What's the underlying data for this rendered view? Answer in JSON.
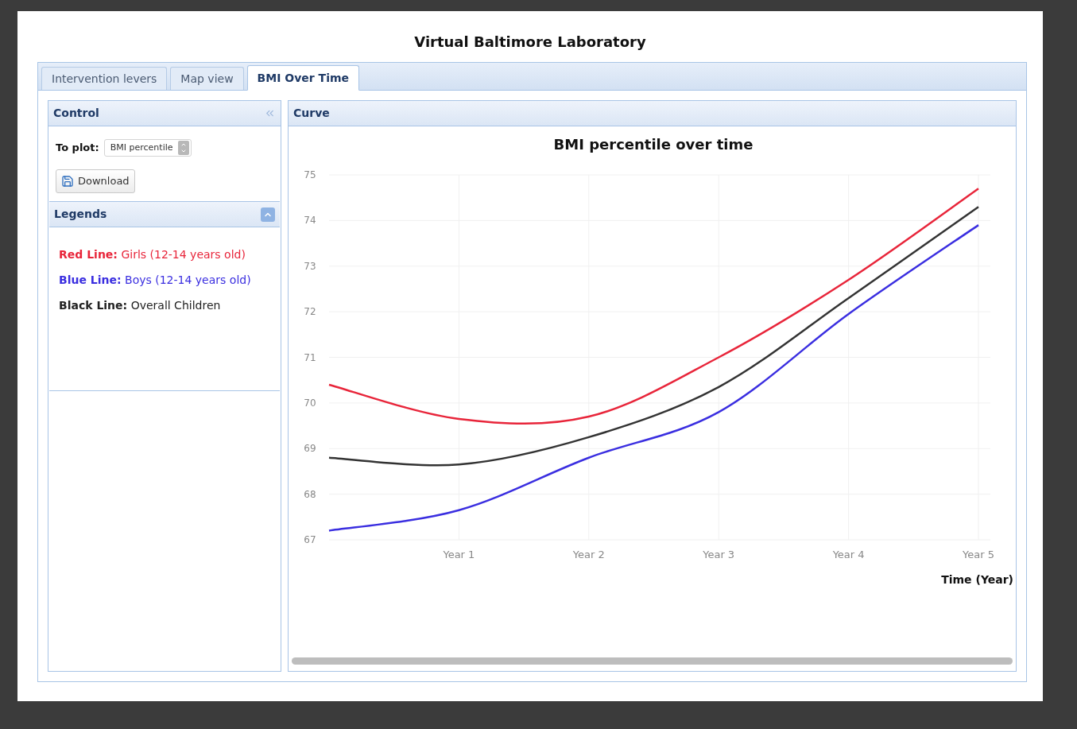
{
  "window": {
    "title": "Virtual Baltimore Laboratory"
  },
  "tabs": [
    {
      "label": "Intervention levers",
      "selected": false
    },
    {
      "label": "Map view",
      "selected": false
    },
    {
      "label": "BMI Over Time",
      "selected": true
    }
  ],
  "control_panel": {
    "title": "Control",
    "plot_label": "To plot:",
    "plot_select": {
      "value": "BMI percentile"
    },
    "download_button": "Download"
  },
  "legends_panel": {
    "title": "Legends",
    "expanded": true,
    "items": [
      {
        "text": "**Red Line:** Girls (12-14 years old)",
        "color": "#e8253a"
      },
      {
        "text": "**Blue Line:** Boys (12-14 years old)",
        "color": "#3a2ee0"
      },
      {
        "text": "**Black Line:** Overall Children",
        "color": "#222222"
      }
    ]
  },
  "curve_panel": {
    "title": "Curve",
    "chart_data": {
      "type": "line",
      "title": "BMI percentile over time",
      "xlabel": "Time (Year)",
      "categories": [
        null,
        "Year 1",
        "Year 2",
        "Year 3",
        "Year 4",
        "Year 5"
      ],
      "series": [
        {
          "color": "#e8253a",
          "values": [
            70.4,
            69.65,
            69.7,
            71.0,
            72.7,
            74.7
          ]
        },
        {
          "color": "#333333",
          "values": [
            68.8,
            68.65,
            69.25,
            70.35,
            72.3,
            74.3
          ]
        },
        {
          "color": "#3a2ee0",
          "values": [
            67.2,
            67.65,
            68.8,
            69.8,
            71.95,
            73.9
          ]
        }
      ],
      "ylim": [
        67,
        75
      ],
      "grid": true,
      "yticks": [
        67,
        68,
        69,
        70,
        71,
        72,
        73,
        74,
        75
      ]
    }
  }
}
